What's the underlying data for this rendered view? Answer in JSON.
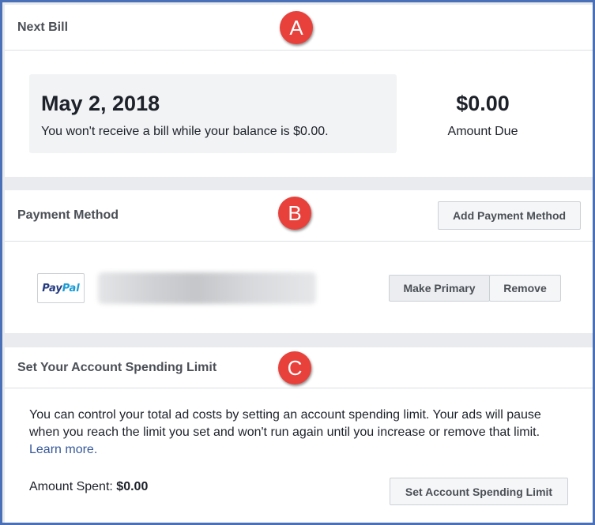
{
  "next_bill": {
    "title": "Next Bill",
    "badge": "A",
    "date": "May 2, 2018",
    "note": "You won't receive a bill while your balance is $0.00.",
    "amount": "$0.00",
    "amount_label": "Amount Due"
  },
  "payment_method": {
    "title": "Payment Method",
    "badge": "B",
    "add_button": "Add Payment Method",
    "provider_logo": {
      "part1": "Pay",
      "part2": "Pal"
    },
    "make_primary_button": "Make Primary",
    "remove_button": "Remove"
  },
  "spending_limit": {
    "title": "Set Your Account Spending Limit",
    "badge": "C",
    "description": "You can control your total ad costs by setting an account spending limit. Your ads will pause when you reach the limit you set and won't run again until you increase or remove that limit.",
    "learn_more": "Learn more.",
    "amount_spent_label": "Amount Spent:",
    "amount_spent_value": "$0.00",
    "set_limit_button": "Set Account Spending Limit"
  },
  "colors": {
    "badge": "#e8413b",
    "frame": "#4a70b8",
    "link": "#365899"
  }
}
